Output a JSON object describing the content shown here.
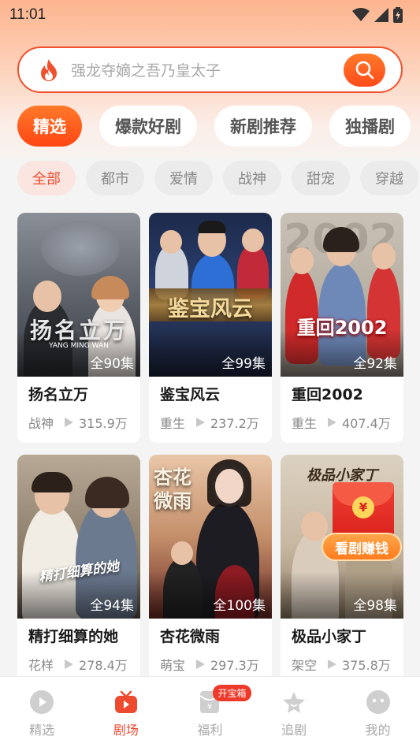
{
  "status_bar": {
    "time": "11:01"
  },
  "search": {
    "placeholder": "强龙夺嫡之吾乃皇太子"
  },
  "tabs": [
    {
      "label": "精选",
      "active": true
    },
    {
      "label": "爆款好剧",
      "active": false
    },
    {
      "label": "新剧推荐",
      "active": false
    },
    {
      "label": "独播剧",
      "active": false
    }
  ],
  "filters": [
    {
      "label": "全部",
      "active": true
    },
    {
      "label": "都市",
      "active": false
    },
    {
      "label": "爱情",
      "active": false
    },
    {
      "label": "战神",
      "active": false
    },
    {
      "label": "甜宠",
      "active": false
    },
    {
      "label": "穿越",
      "active": false
    }
  ],
  "dramas": [
    {
      "title": "扬名立万",
      "episodes": "全90集",
      "genre": "战神",
      "views": "315.9万",
      "poster_text": "扬名立万"
    },
    {
      "title": "鉴宝风云",
      "episodes": "全99集",
      "genre": "重生",
      "views": "237.2万",
      "poster_text": "鉴宝风云"
    },
    {
      "title": "重回2002",
      "episodes": "全92集",
      "genre": "重生",
      "views": "407.4万",
      "poster_text": "重回2002"
    },
    {
      "title": "精打细算的她",
      "episodes": "全94集",
      "genre": "花样",
      "views": "278.4万",
      "poster_text": "精打细算的她"
    },
    {
      "title": "杏花微雨",
      "episodes": "全100集",
      "genre": "萌宝",
      "views": "297.3万",
      "poster_text": "杏花微雨"
    },
    {
      "title": "极品小家丁",
      "episodes": "全98集",
      "genre": "架空",
      "views": "375.8万",
      "poster_text": "极品小家丁"
    }
  ],
  "poster1_sub": "YANG  MING  WAN",
  "red_packet": {
    "coin": "¥",
    "label": "看剧赚钱"
  },
  "bottom_nav": [
    {
      "label": "精选",
      "icon": "play-circle-icon",
      "active": false
    },
    {
      "label": "剧场",
      "icon": "tv-icon",
      "active": true
    },
    {
      "label": "福利",
      "icon": "red-envelope-icon",
      "active": false,
      "badge": "开宝箱"
    },
    {
      "label": "追剧",
      "icon": "star-icon",
      "active": false
    },
    {
      "label": "我的",
      "icon": "profile-face-icon",
      "active": false
    }
  ],
  "colors": {
    "accent": "#ee4a30",
    "accent_orange": "#ff6a20"
  }
}
